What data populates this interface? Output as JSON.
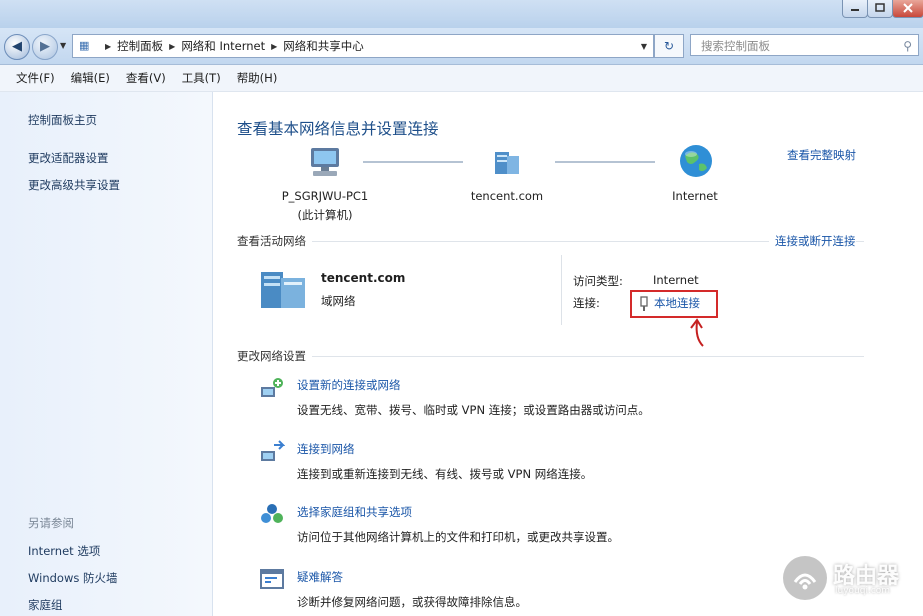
{
  "breadcrumb": [
    "控制面板",
    "网络和 Internet",
    "网络和共享中心"
  ],
  "search": {
    "placeholder": "搜索控制面板"
  },
  "menu": [
    "文件(F)",
    "编辑(E)",
    "查看(V)",
    "工具(T)",
    "帮助(H)"
  ],
  "sidebar": {
    "links": [
      "控制面板主页",
      "更改适配器设置",
      "更改高级共享设置"
    ],
    "see_also_title": "另请参阅",
    "see_also": [
      "Internet 选项",
      "Windows 防火墙",
      "家庭组"
    ]
  },
  "main": {
    "title": "查看基本网络信息并设置连接",
    "full_map_link": "查看完整映射",
    "nodes": [
      {
        "label": "P_SGRJWU-PC1",
        "sublabel": "(此计算机)",
        "icon": "computer-icon"
      },
      {
        "label": "tencent.com",
        "icon": "network-icon"
      },
      {
        "label": "Internet",
        "icon": "globe-icon"
      }
    ],
    "active_networks": {
      "title": "查看活动网络",
      "connect_link": "连接或断开连接",
      "network_name": "tencent.com",
      "network_type": "域网络",
      "access_type_label": "访问类型:",
      "access_type_value": "Internet",
      "connections_label": "连接:",
      "connection_value": "本地连接"
    },
    "change_settings": {
      "title": "更改网络设置",
      "tasks": [
        {
          "title": "设置新的连接或网络",
          "desc": "设置无线、宽带、拨号、临时或 VPN 连接；或设置路由器或访问点。",
          "icon": "new-connection-icon"
        },
        {
          "title": "连接到网络",
          "desc": "连接到或重新连接到无线、有线、拨号或 VPN 网络连接。",
          "icon": "connect-network-icon"
        },
        {
          "title": "选择家庭组和共享选项",
          "desc": "访问位于其他网络计算机上的文件和打印机，或更改共享设置。",
          "icon": "homegroup-icon"
        },
        {
          "title": "疑难解答",
          "desc": "诊断并修复网络问题，或获得故障排除信息。",
          "icon": "troubleshoot-icon"
        }
      ]
    }
  },
  "watermark": {
    "text": "路由器",
    "url": "luyouqi.com"
  },
  "colors": {
    "accent": "#1a56a8",
    "highlight_box": "#d42a2a"
  }
}
